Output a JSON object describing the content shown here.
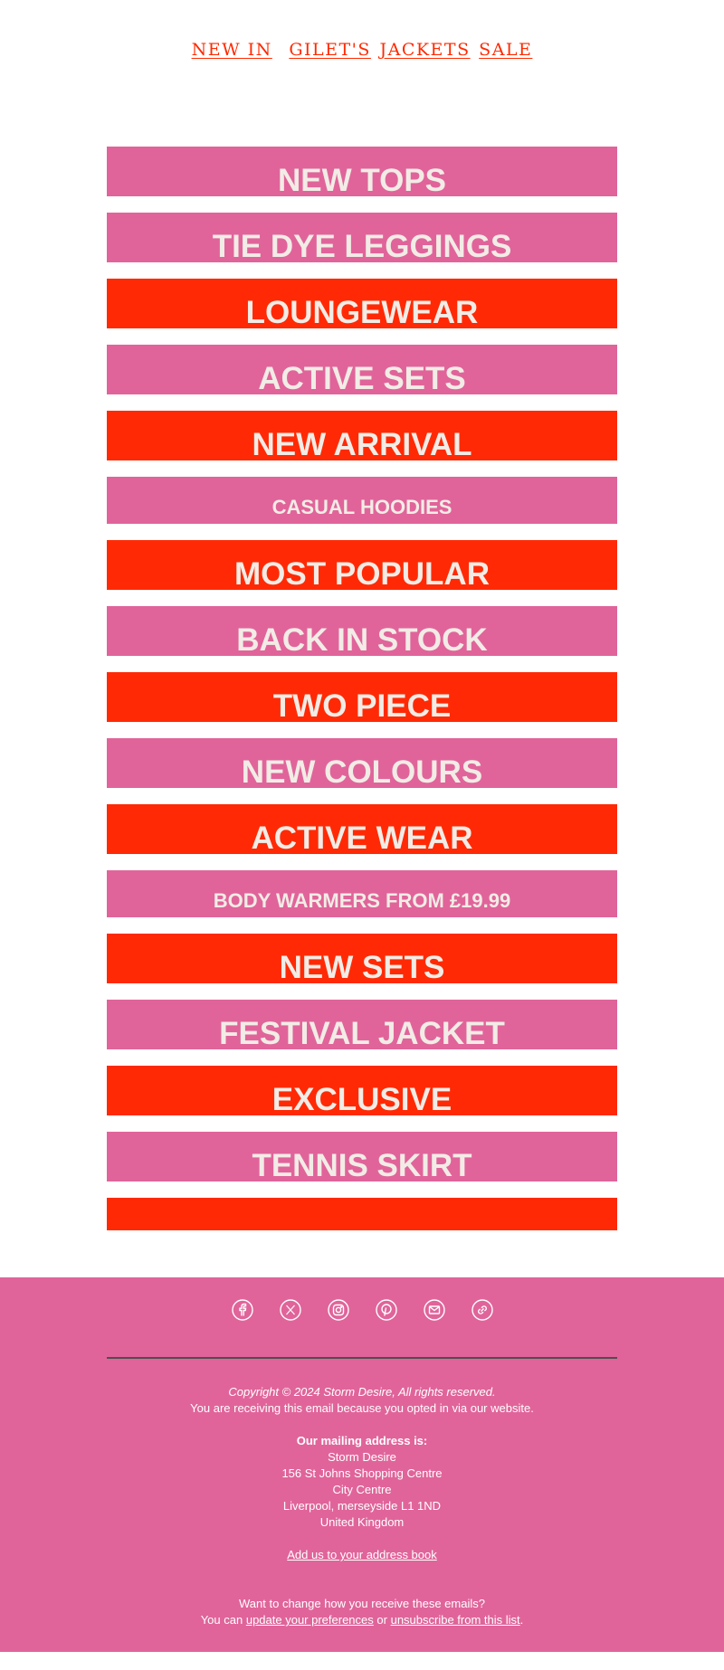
{
  "nav": {
    "new_in": "NEW IN",
    "gilets": "GILET'S",
    "jackets": "JACKETS",
    "sale": "SALE"
  },
  "colors": {
    "pink": "#e0649a",
    "red": "#ff2a05",
    "banner_text": "#f2ece6",
    "nav_text": "#ff2a00"
  },
  "banners": [
    {
      "label": "NEW TOPS",
      "color": "pink"
    },
    {
      "label": "TIE DYE LEGGINGS",
      "color": "pink"
    },
    {
      "label": "LOUNGEWEAR",
      "color": "red"
    },
    {
      "label": "ACTIVE SETS",
      "color": "pink"
    },
    {
      "label": "NEW ARRIVAL",
      "color": "red"
    },
    {
      "label": "CASUAL HOODIES",
      "color": "pink"
    },
    {
      "label": "MOST POPULAR",
      "color": "red"
    },
    {
      "label": "BACK IN STOCK",
      "color": "pink"
    },
    {
      "label": "TWO PIECE",
      "color": "red"
    },
    {
      "label": "NEW COLOURS",
      "color": "pink"
    },
    {
      "label": "ACTIVE WEAR",
      "color": "red"
    },
    {
      "label": "BODY WARMERS FROM £19.99",
      "color": "pink"
    },
    {
      "label": "NEW SETS",
      "color": "red"
    },
    {
      "label": "FESTIVAL JACKET",
      "color": "pink"
    },
    {
      "label": "EXCLUSIVE",
      "color": "red"
    },
    {
      "label": "TENNIS SKIRT",
      "color": "pink"
    },
    {
      "label": "",
      "color": "red"
    }
  ],
  "footer": {
    "social_icons": [
      "facebook-icon",
      "x-icon",
      "instagram-icon",
      "pinterest-icon",
      "email-icon",
      "link-icon"
    ],
    "copyright": "Copyright © 2024 Storm Desire, All rights reserved.",
    "optin": "You are receiving this email because you opted in via our website.",
    "mailing_heading": "Our mailing address is:",
    "address": [
      "Storm Desire",
      "156 St Johns Shopping Centre",
      "City Centre",
      "Liverpool, merseyside L1 1ND",
      "United Kingdom"
    ],
    "address_book_link": "Add us to your address book",
    "change_text": "Want to change how you receive these emails?",
    "you_can": "You can",
    "update_link": "update your preferences",
    "or": "or",
    "unsubscribe_link": "unsubscribe from this list",
    "period": "."
  }
}
